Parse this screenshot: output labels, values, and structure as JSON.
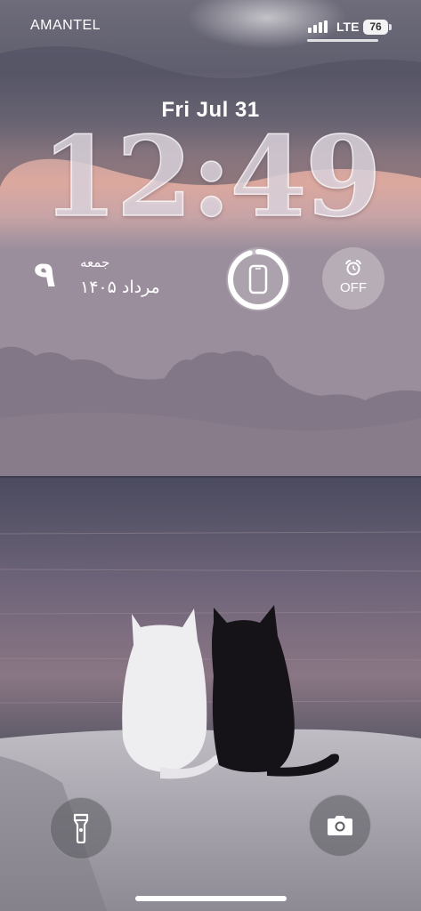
{
  "status_bar": {
    "carrier": "AMANTEL",
    "network": "LTE",
    "battery_percent": "76"
  },
  "lock_screen": {
    "date": "Fri Jul 31",
    "time": "12:49"
  },
  "widgets": {
    "calendar": {
      "day_number": "٩",
      "weekday": "جمعه",
      "month_year": "مرداد ۱۴۰۵"
    },
    "battery_ring": {
      "level": 0.95
    },
    "alarm": {
      "status": "OFF"
    }
  },
  "quick_actions": {
    "flashlight": "flashlight-icon",
    "camera": "camera-icon"
  }
}
